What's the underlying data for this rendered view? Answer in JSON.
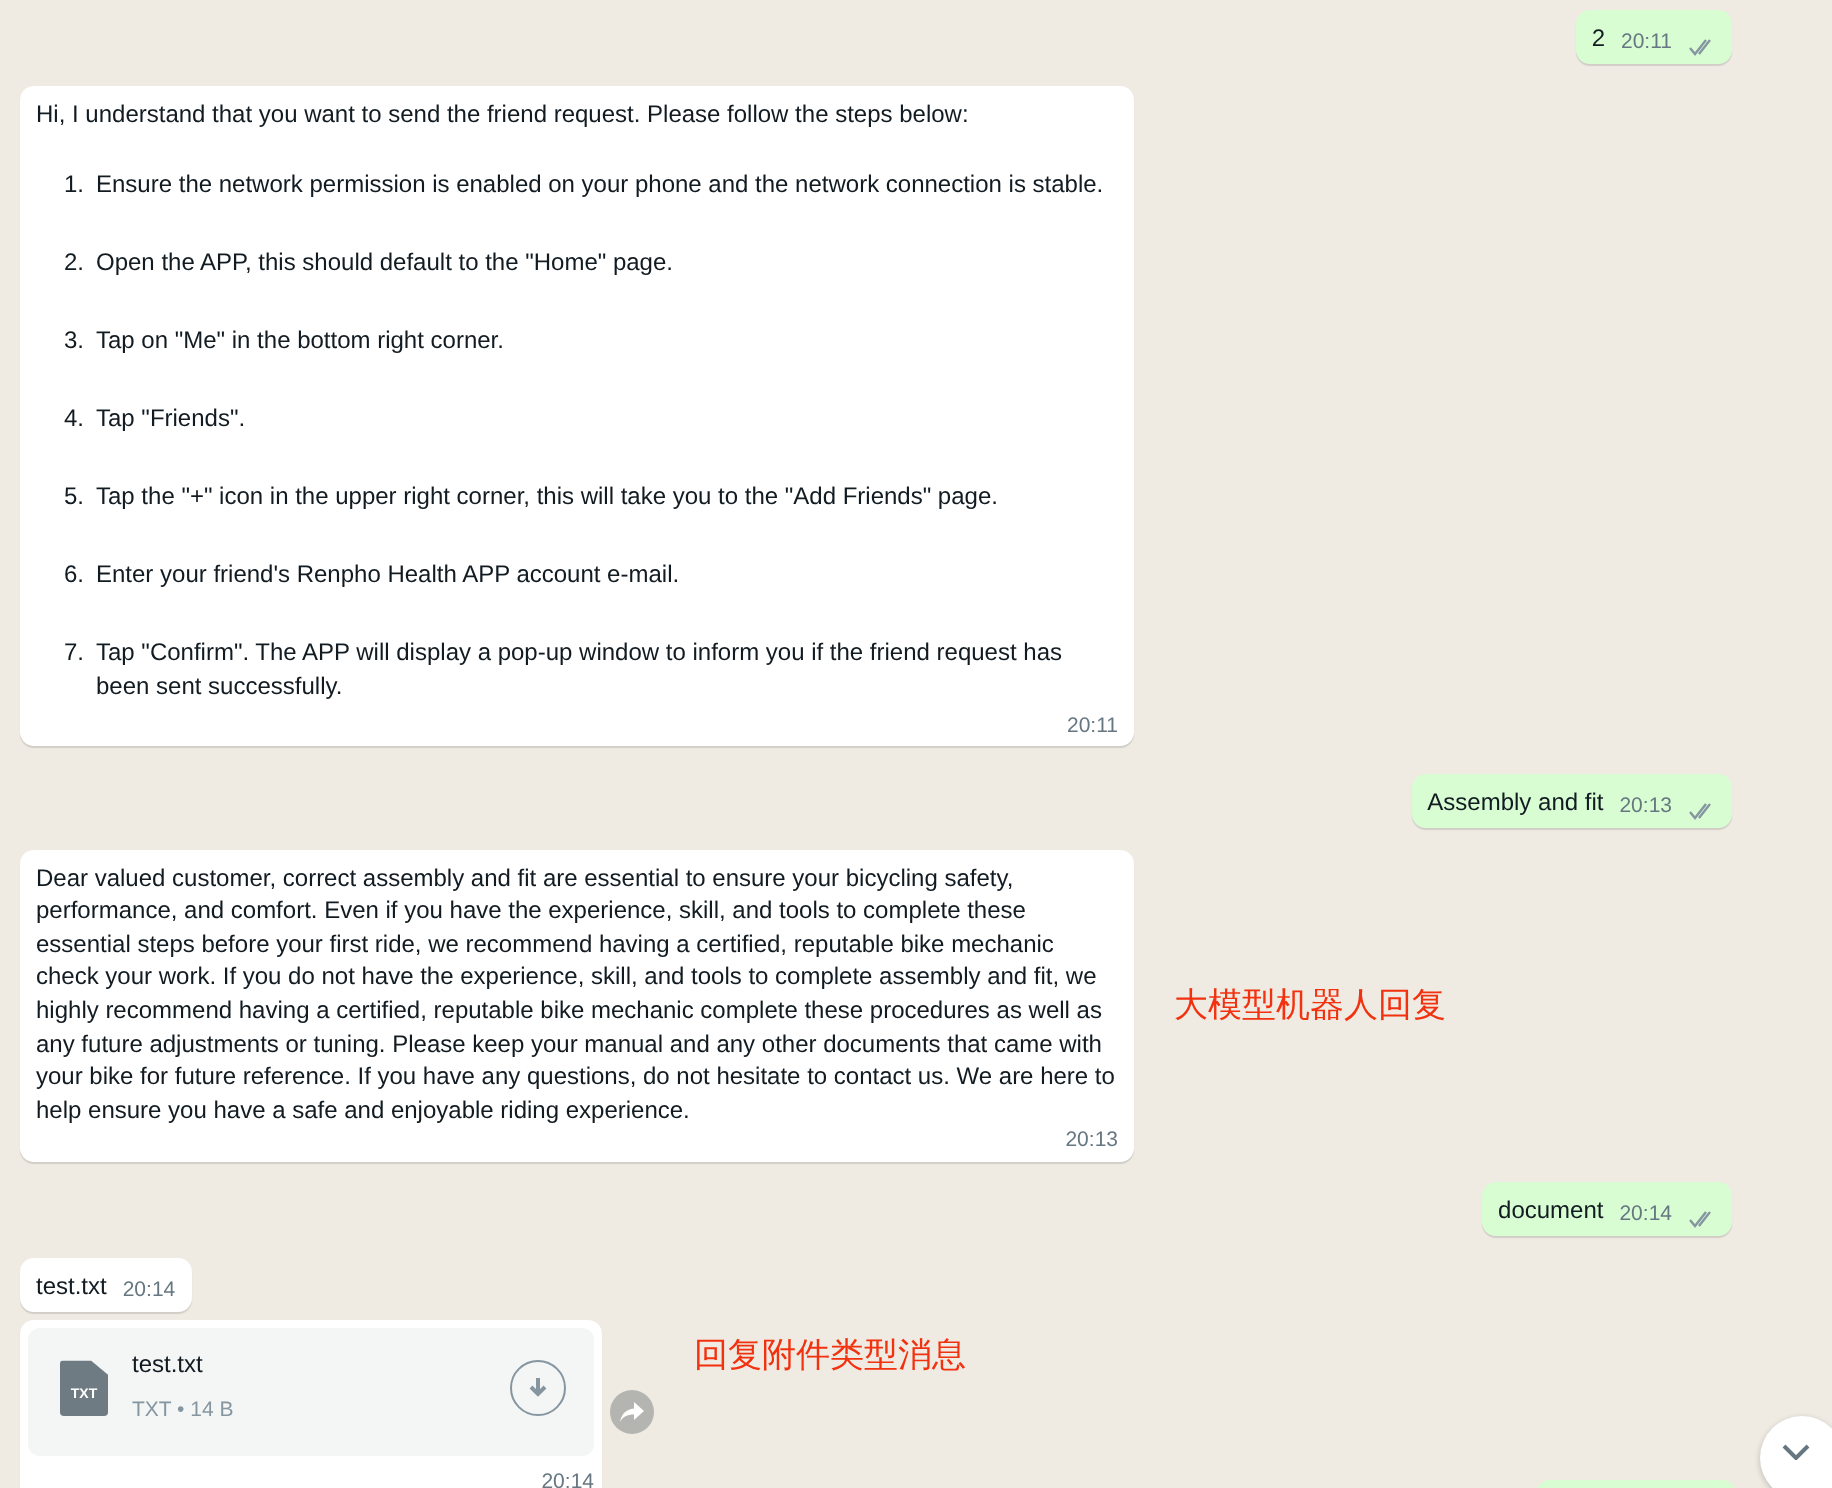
{
  "messages": [
    {
      "kind": "sent",
      "text": "2",
      "time": "20:11"
    },
    {
      "kind": "steps",
      "intro": "Hi, I understand that you want to send the friend request. Please follow the steps below:",
      "steps": [
        {
          "number": "1.",
          "text": "Ensure the network permission is enabled on your phone and the network connection is stable."
        },
        {
          "number": "2.",
          "text": "Open the APP, this should default to the \"Home\" page."
        },
        {
          "number": "3.",
          "text": "Tap on \"Me\" in the bottom right corner."
        },
        {
          "number": "4.",
          "text": "Tap \"Friends\"."
        },
        {
          "number": "5.",
          "text": "Tap the \"+\" icon in the upper right corner, this will take you to the \"Add Friends\" page."
        },
        {
          "number": "6.",
          "text": "Enter your friend's Renpho Health APP account e-mail."
        },
        {
          "number": "7.",
          "text": "Tap \"Confirm\". The APP will display a pop-up window to inform you if the friend request has been sent successfully."
        }
      ],
      "time": "20:11"
    },
    {
      "kind": "sent",
      "text": "Assembly and fit",
      "time": "20:13"
    },
    {
      "kind": "received",
      "text": "Dear valued customer, correct assembly and fit are essential to ensure your bicycling safety, performance, and comfort. Even if you have the experience, skill, and tools to complete these essential steps before your first ride, we recommend having a certified, reputable bike mechanic check your work. If you do not have the experience, skill, and tools to complete assembly and fit, we highly recommend having a certified, reputable bike mechanic complete these procedures as well as any future adjustments or tuning. Please keep your manual and any other documents that came with your bike for future reference. If you have any questions, do not hesitate to contact us. We are here to help ensure you have a safe and enjoyable riding experience.",
      "time": "20:13",
      "note": "大模型机器人回复"
    },
    {
      "kind": "sent",
      "text": "document",
      "time": "20:14"
    },
    {
      "kind": "received",
      "text": "test.txt",
      "time": "20:14"
    },
    {
      "kind": "file",
      "file_type": "TXT",
      "name": "test.txt",
      "meta": "TXT • 14 B",
      "time": "20:14",
      "note": "回复附件类型消息"
    }
  ]
}
